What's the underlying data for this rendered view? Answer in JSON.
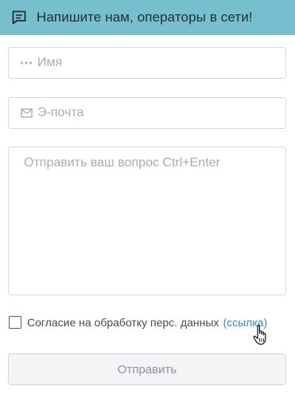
{
  "header": {
    "title": "Напишите нам, операторы в сети!",
    "icon": "chat-bubble-icon",
    "background": "#77bfcf"
  },
  "form": {
    "name_field": {
      "placeholder": "Имя",
      "value": "",
      "icon": "dots-icon"
    },
    "email_field": {
      "placeholder": "Э-почта",
      "value": "",
      "icon": "envelope-icon"
    },
    "message_field": {
      "placeholder": "Отправить ваш вопрос Ctrl+Enter",
      "value": ""
    },
    "consent": {
      "checked": false,
      "label": "Согласие на обработку перс. данных",
      "link_label": "(ссылка)",
      "link_color": "#2b8fc2"
    },
    "submit_label": "Отправить"
  }
}
